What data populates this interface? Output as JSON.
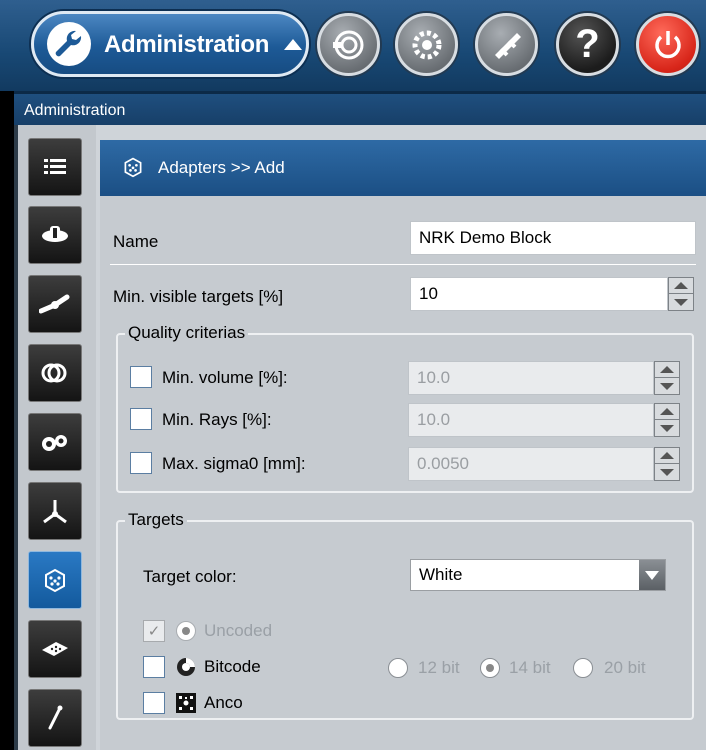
{
  "toolbar": {
    "admin_label": "Administration",
    "icons": [
      "wrench-icon",
      "measure-icon",
      "gear-icon",
      "caliper-icon",
      "help-icon",
      "power-icon"
    ]
  },
  "titleband": {
    "title": "Administration"
  },
  "sidebar": {
    "items": [
      {
        "icon": "list-icon"
      },
      {
        "icon": "scanner-icon"
      },
      {
        "icon": "arm-icon"
      },
      {
        "icon": "target-rings-icon"
      },
      {
        "icon": "cameras-icon"
      },
      {
        "icon": "axes-icon"
      },
      {
        "icon": "adapter-icon",
        "active": true
      },
      {
        "icon": "plate-icon"
      },
      {
        "icon": "probe-icon"
      }
    ]
  },
  "content": {
    "breadcrumb": "Adapters >> Add",
    "name_label": "Name",
    "name_value": "NRK Demo Block",
    "min_visible_label": "Min. visible targets [%]",
    "min_visible_value": "10",
    "quality": {
      "title": "Quality criterias",
      "min_volume_label": "Min. volume [%]:",
      "min_volume_value": "10.0",
      "min_rays_label": "Min. Rays [%]:",
      "min_rays_value": "10.0",
      "max_sigma_label": "Max. sigma0 [mm]:",
      "max_sigma_value": "0.0050"
    },
    "targets": {
      "title": "Targets",
      "color_label": "Target color:",
      "color_value": "White",
      "uncoded_label": "Uncoded",
      "bitcode_label": "Bitcode",
      "anco_label": "Anco",
      "bit12": "12 bit",
      "bit14": "14 bit",
      "bit20": "20 bit",
      "selected_bits": "14 bit"
    }
  }
}
